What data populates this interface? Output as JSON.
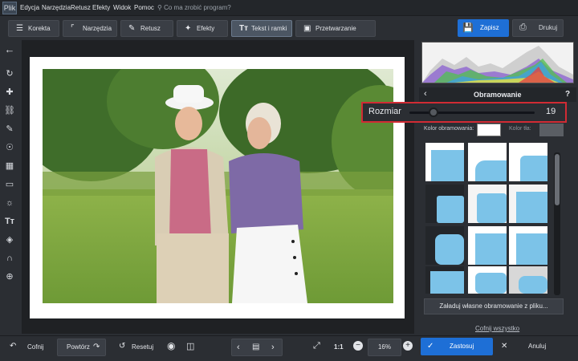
{
  "menubar": {
    "items": [
      "Plik",
      "Edycja",
      "Narzędzia",
      "Retusz",
      "Efekty",
      "Widok",
      "Pomoc"
    ],
    "search_placeholder": "Co ma zrobić program?"
  },
  "tabs": [
    {
      "label": "Korekta",
      "icon": "sliders-icon"
    },
    {
      "label": "Narzędzia",
      "icon": "crop-icon"
    },
    {
      "label": "Retusz",
      "icon": "brush-icon"
    },
    {
      "label": "Efekty",
      "icon": "magic-wand-icon"
    },
    {
      "label": "Tekst i ramki",
      "icon": "text-icon"
    },
    {
      "label": "Przetwarzanie wsadowe",
      "icon": "images-icon"
    }
  ],
  "actions": {
    "save_label": "Zapisz",
    "print_label": "Drukuj"
  },
  "panel": {
    "title": "Obramowanie",
    "help": "?",
    "size_label": "Rozmiar",
    "size_value": "19",
    "size_fraction": 0.19,
    "border_color_label": "Kolor obramowania:",
    "bg_color_label": "Kolor tła:",
    "border_color": "#ffffff",
    "bg_color": "#5a5e64",
    "load_button": "Załaduj własne obramowanie z pliku...",
    "undo_all": "Cofnij wszystko"
  },
  "bottom": {
    "undo_label": "Cofnij",
    "redo_label": "Powtórz",
    "reset_label": "Resetuj",
    "zoom_ratio": "1:1",
    "zoom_value": "16%",
    "apply_label": "Zastosuj",
    "cancel_label": "Anuluj"
  },
  "colors": {
    "accent": "#1e6fd6",
    "highlight": "#d12b34",
    "thumb_blue": "#7cc3e8"
  }
}
